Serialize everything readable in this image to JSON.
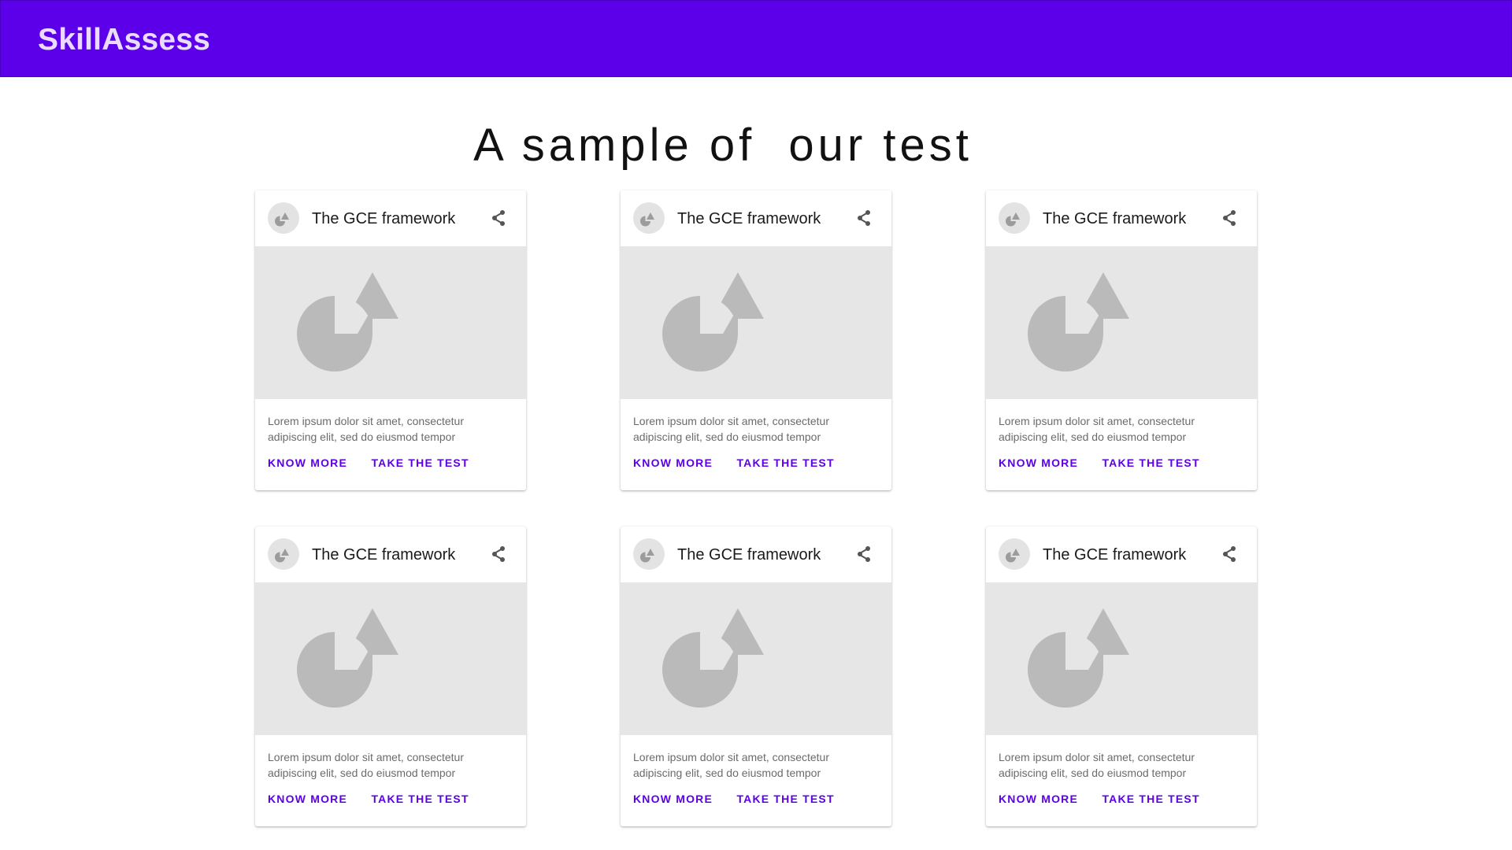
{
  "app": {
    "brand": "SkillAssess",
    "heading": "A sample of  our test",
    "colors": {
      "primary": "#5c00ea",
      "brand_text": "#e9dcff",
      "media_bg": "#e6e6e6",
      "placeholder_shape": "#bababa"
    }
  },
  "cards": [
    {
      "title": "The GCE framework",
      "description": "Lorem ipsum dolor sit amet, consectetur adipiscing elit, sed do eiusmod tempor",
      "know_more": "KNOW MORE",
      "take_test": "TAKE THE TEST",
      "avatar_icon": "image-placeholder-icon",
      "share_icon": "share-icon"
    },
    {
      "title": "The GCE framework",
      "description": "Lorem ipsum dolor sit amet, consectetur adipiscing elit, sed do eiusmod tempor",
      "know_more": "KNOW MORE",
      "take_test": "TAKE THE TEST",
      "avatar_icon": "image-placeholder-icon",
      "share_icon": "share-icon"
    },
    {
      "title": "The GCE framework",
      "description": "Lorem ipsum dolor sit amet, consectetur adipiscing elit, sed do eiusmod tempor",
      "know_more": "KNOW MORE",
      "take_test": "TAKE THE TEST",
      "avatar_icon": "image-placeholder-icon",
      "share_icon": "share-icon"
    },
    {
      "title": "The GCE framework",
      "description": "Lorem ipsum dolor sit amet, consectetur adipiscing elit, sed do eiusmod tempor",
      "know_more": "KNOW MORE",
      "take_test": "TAKE THE TEST",
      "avatar_icon": "image-placeholder-icon",
      "share_icon": "share-icon"
    },
    {
      "title": "The GCE framework",
      "description": "Lorem ipsum dolor sit amet, consectetur adipiscing elit, sed do eiusmod tempor",
      "know_more": "KNOW MORE",
      "take_test": "TAKE THE TEST",
      "avatar_icon": "image-placeholder-icon",
      "share_icon": "share-icon"
    },
    {
      "title": "The GCE framework",
      "description": "Lorem ipsum dolor sit amet, consectetur adipiscing elit, sed do eiusmod tempor",
      "know_more": "KNOW MORE",
      "take_test": "TAKE THE TEST",
      "avatar_icon": "image-placeholder-icon",
      "share_icon": "share-icon"
    }
  ]
}
